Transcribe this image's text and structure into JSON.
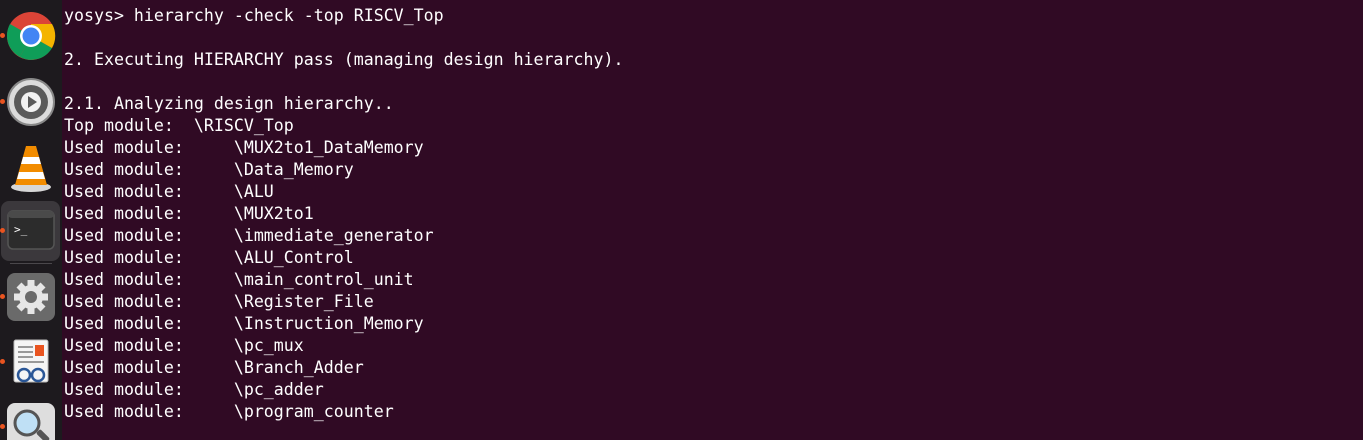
{
  "dock": {
    "items": [
      {
        "name": "chrome",
        "icon": "chrome-icon",
        "running": true,
        "active": false
      },
      {
        "name": "rhythmbox",
        "icon": "music-player-icon",
        "running": true,
        "active": false
      },
      {
        "name": "vlc",
        "icon": "vlc-cone-icon",
        "running": false,
        "active": false
      },
      {
        "name": "terminal",
        "icon": "terminal-icon",
        "running": true,
        "active": true
      },
      {
        "name": "settings",
        "icon": "gear-icon",
        "running": true,
        "active": false
      },
      {
        "name": "document-viewer",
        "icon": "document-viewer-icon",
        "running": true,
        "active": false
      },
      {
        "name": "image-viewer",
        "icon": "magnifier-icon",
        "running": true,
        "active": false
      }
    ],
    "terminal_glyph": ">_",
    "accent_color": "#e95420"
  },
  "terminal": {
    "background": "#300a24",
    "foreground": "#ffffff",
    "lines": [
      "yosys> hierarchy -check -top RISCV_Top",
      "",
      "2. Executing HIERARCHY pass (managing design hierarchy).",
      "",
      "2.1. Analyzing design hierarchy..",
      "Top module:  \\RISCV_Top",
      "Used module:     \\MUX2to1_DataMemory",
      "Used module:     \\Data_Memory",
      "Used module:     \\ALU",
      "Used module:     \\MUX2to1",
      "Used module:     \\immediate_generator",
      "Used module:     \\ALU_Control",
      "Used module:     \\main_control_unit",
      "Used module:     \\Register_File",
      "Used module:     \\Instruction_Memory",
      "Used module:     \\pc_mux",
      "Used module:     \\Branch_Adder",
      "Used module:     \\pc_adder",
      "Used module:     \\program_counter"
    ]
  }
}
